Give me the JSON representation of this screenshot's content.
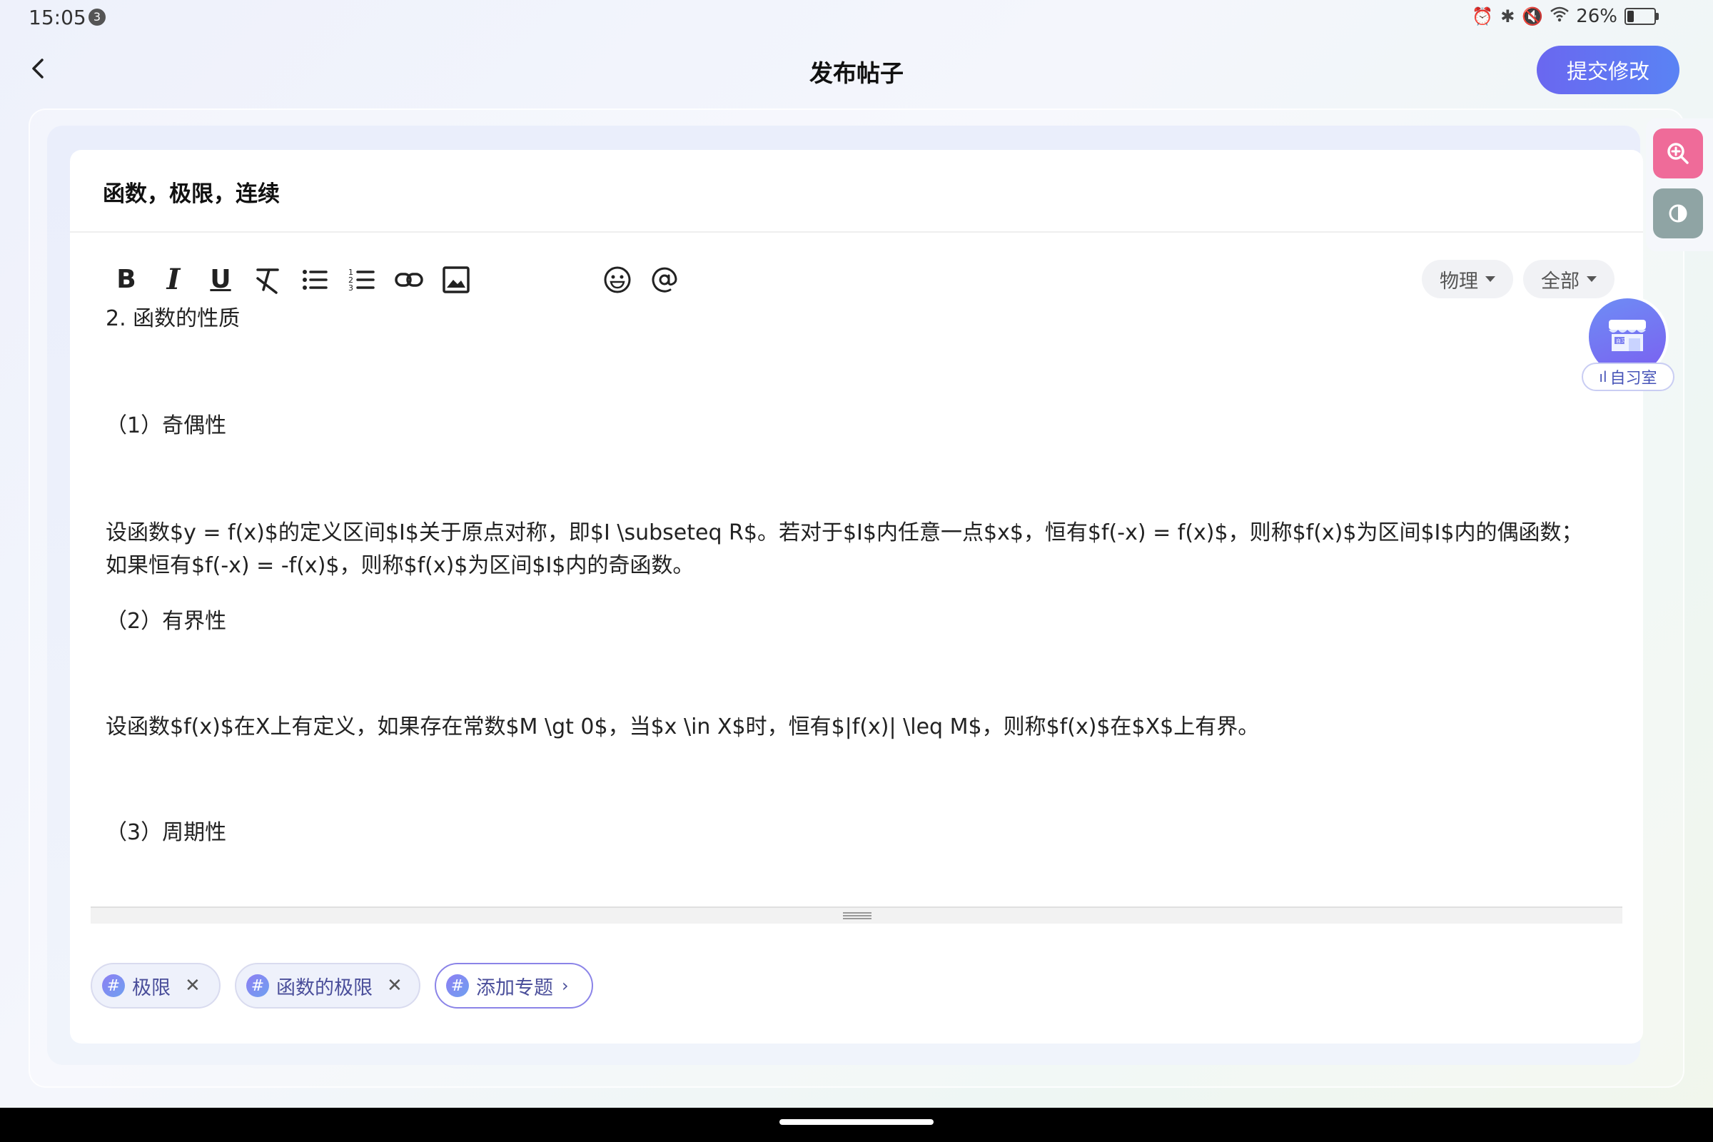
{
  "status_bar": {
    "time": "15:05",
    "notification_count": "3",
    "battery": "26%",
    "battery_level": 0.26,
    "icons": [
      "alarm-icon",
      "bluetooth-icon",
      "mute-icon",
      "wifi-icon",
      "battery-icon"
    ]
  },
  "header": {
    "title": "发布帖子",
    "submit_label": "提交修改"
  },
  "post": {
    "title": "函数，极限，连续"
  },
  "toolbar": {
    "bold": "B",
    "italic": "I",
    "underline": "U",
    "icons": [
      "bold-icon",
      "italic-icon",
      "underline-icon",
      "clear-format-icon",
      "bullet-list-icon",
      "numbered-list-icon",
      "link-icon",
      "image-icon",
      "emoji-icon",
      "mention-icon"
    ]
  },
  "filters": {
    "subject": "物理",
    "scope": "全部"
  },
  "editor": {
    "lines": [
      "2. 函数的性质",
      "（1）奇偶性",
      "设函数$y = f(x)$的定义区间$I$关于原点对称，即$I \\subseteq R$。若对于$I$内任意一点$x$，恒有$f(-x) = f(x)$，则称$f(x)$为区间$I$内的偶函数；",
      "如果恒有$f(-x) = -f(x)$，则称$f(x)$为区间$I$内的奇函数。",
      "（2）有界性",
      "设函数$f(x)$在X上有定义，如果存在常数$M \\gt 0$，当$x \\in X$时，恒有$|f(x)| \\leq M$，则称$f(x)$在$X$上有界。",
      "（3）周期性"
    ]
  },
  "tags": [
    {
      "label": "极限"
    },
    {
      "label": "函数的极限"
    }
  ],
  "add_topic_label": "添加专题",
  "study_room": {
    "label": "自习室",
    "badge": "自习"
  },
  "colors": {
    "accent": "#6a67f0",
    "pink_button": "#ef6b99",
    "gray_button": "#8fa4a4"
  }
}
